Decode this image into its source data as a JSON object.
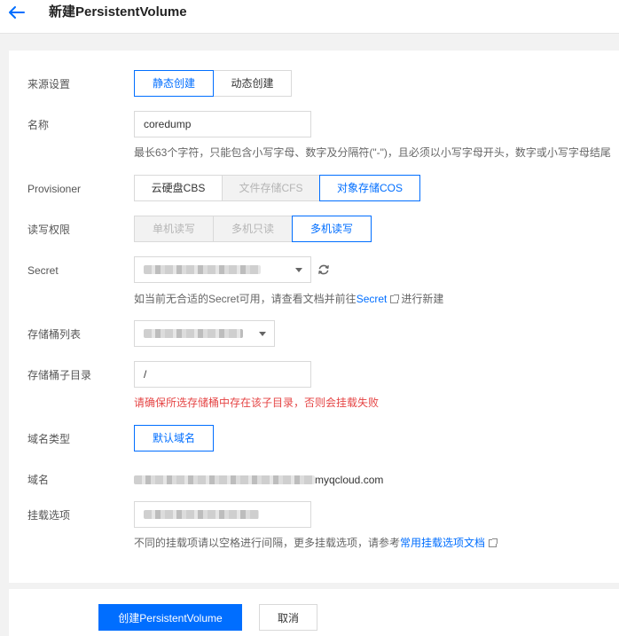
{
  "header": {
    "title": "新建PersistentVolume"
  },
  "form": {
    "source": {
      "label": "来源设置",
      "options": [
        "静态创建",
        "动态创建"
      ]
    },
    "name": {
      "label": "名称",
      "value": "coredump",
      "help": "最长63个字符，只能包含小写字母、数字及分隔符(\"-\")，且必须以小写字母开头，数字或小写字母结尾"
    },
    "provisioner": {
      "label": "Provisioner",
      "options": [
        "云硬盘CBS",
        "文件存储CFS",
        "对象存储COS"
      ]
    },
    "access": {
      "label": "读写权限",
      "options": [
        "单机读写",
        "多机只读",
        "多机读写"
      ]
    },
    "secret": {
      "label": "Secret",
      "help_prefix": "如当前无合适的Secret可用，请查看文档并前往",
      "help_link": "Secret",
      "help_suffix": "进行新建"
    },
    "bucket": {
      "label": "存储桶列表"
    },
    "subdir": {
      "label": "存储桶子目录",
      "value": "/",
      "warning": "请确保所选存储桶中存在该子目录，否则会挂载失败"
    },
    "domain_type": {
      "label": "域名类型",
      "option": "默认域名"
    },
    "domain": {
      "label": "域名",
      "suffix": "myqcloud.com"
    },
    "mount": {
      "label": "挂载选项",
      "help_prefix": "不同的挂载项请以空格进行间隔，更多挂载选项，请参考",
      "help_link": "常用挂载选项文档"
    }
  },
  "footer": {
    "create_label": "创建PersistentVolume",
    "cancel_label": "取消"
  },
  "colors": {
    "accent": "#006eff",
    "warning": "#e54545"
  }
}
